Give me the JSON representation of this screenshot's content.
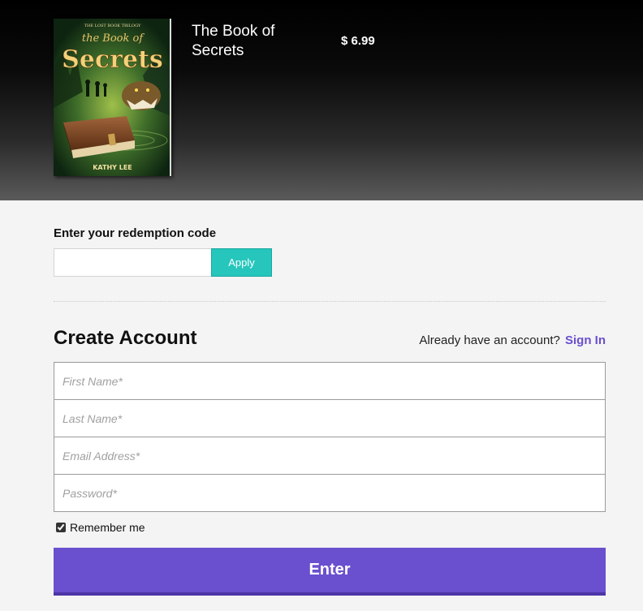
{
  "product": {
    "title": "The Book of Secrets",
    "price": "$ 6.99",
    "cover": {
      "series": "THE LOST BOOK TRILOGY",
      "title_line1": "the Book of",
      "title_line2": "Secrets",
      "author": "KATHY LEE"
    }
  },
  "redemption": {
    "label": "Enter your redemption code",
    "input_value": "",
    "apply_label": "Apply"
  },
  "account": {
    "title": "Create Account",
    "already_text": "Already have an account?",
    "signin_label": "Sign In",
    "fields": {
      "first_name_placeholder": "First Name*",
      "last_name_placeholder": "Last Name*",
      "email_placeholder": "Email Address*",
      "password_placeholder": "Password*"
    },
    "remember_label": "Remember me",
    "remember_checked": true,
    "enter_label": "Enter"
  },
  "colors": {
    "accent_purple": "#6a4fcf",
    "apply_teal": "#26c6bc",
    "background": "#f4f4f4"
  }
}
